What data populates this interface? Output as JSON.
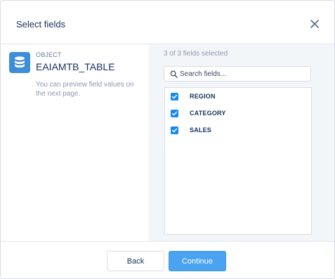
{
  "dialog": {
    "title": "Select fields"
  },
  "object": {
    "kicker": "OBJECT",
    "name": "EAIAMTB_TABLE",
    "hint": "You can preview field values on the next page.",
    "icon": "database-icon"
  },
  "fields": {
    "count_text": "3 of 3 fields selected",
    "search": {
      "placeholder": "Search fields...",
      "value": ""
    },
    "items": [
      {
        "label": "REGION",
        "checked": true
      },
      {
        "label": "CATEGORY",
        "checked": true
      },
      {
        "label": "SALES",
        "checked": true
      }
    ]
  },
  "footer": {
    "back_label": "Back",
    "continue_label": "Continue"
  },
  "colors": {
    "accent": "#1589ee",
    "primary_button": "#4aa3f0",
    "panel_bg": "#f3f6f9",
    "text": "#16325c"
  }
}
